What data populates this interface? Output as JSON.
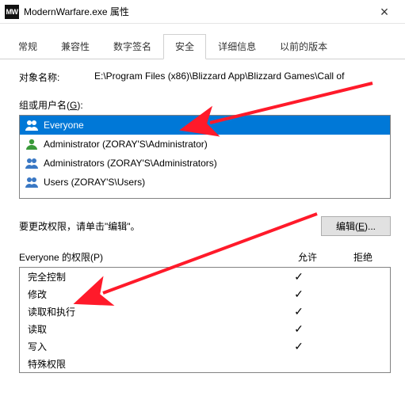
{
  "window": {
    "icon_text": "MW",
    "title": "ModernWarfare.exe 属性"
  },
  "tabs": [
    {
      "label": "常规"
    },
    {
      "label": "兼容性"
    },
    {
      "label": "数字签名"
    },
    {
      "label": "安全"
    },
    {
      "label": "详细信息"
    },
    {
      "label": "以前的版本"
    }
  ],
  "active_tab_index": 3,
  "object_row": {
    "label": "对象名称:",
    "value": "E:\\Program Files (x86)\\Blizzard App\\Blizzard Games\\Call of"
  },
  "group_caption": {
    "pre": "组或用户名(",
    "hot": "G",
    "post": "):"
  },
  "users": [
    {
      "label": "Everyone",
      "type": "group",
      "selected": true
    },
    {
      "label": "Administrator (ZORAY'S\\Administrator)",
      "type": "user",
      "selected": false
    },
    {
      "label": "Administrators (ZORAY'S\\Administrators)",
      "type": "group",
      "selected": false
    },
    {
      "label": "Users (ZORAY'S\\Users)",
      "type": "group",
      "selected": false
    }
  ],
  "edit_hint": "要更改权限，请单击\"编辑\"。",
  "edit_button": {
    "pre": "编辑(",
    "hot": "E",
    "post": ")..."
  },
  "perm_caption": {
    "pre": "Everyone 的权限(",
    "hot": "P",
    "post": ")"
  },
  "perm_headers": {
    "allow": "允许",
    "deny": "拒绝"
  },
  "permissions": [
    {
      "name": "完全控制",
      "allow": true,
      "deny": false
    },
    {
      "name": "修改",
      "allow": true,
      "deny": false
    },
    {
      "name": "读取和执行",
      "allow": true,
      "deny": false
    },
    {
      "name": "读取",
      "allow": true,
      "deny": false
    },
    {
      "name": "写入",
      "allow": true,
      "deny": false
    },
    {
      "name": "特殊权限",
      "allow": false,
      "deny": false
    }
  ],
  "annotation_color": "#ff1a2a"
}
